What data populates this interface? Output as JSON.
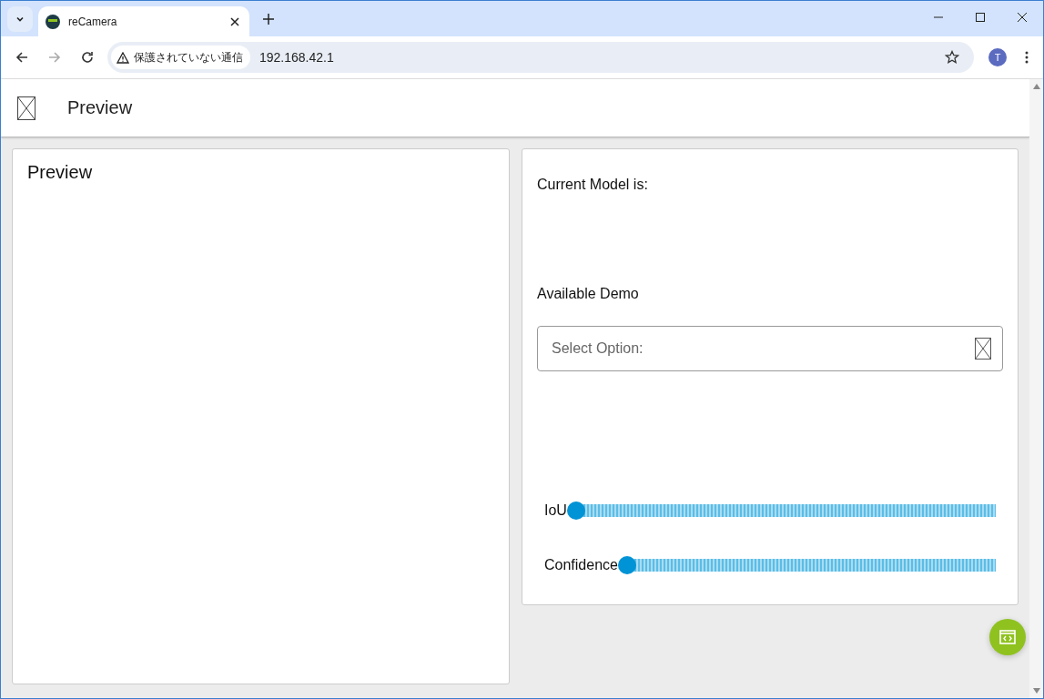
{
  "browser": {
    "tab_title": "reCamera",
    "security_label": "保護されていない通信",
    "url": "192.168.42.1",
    "profile_initial": "T"
  },
  "header": {
    "title": "Preview"
  },
  "preview_card": {
    "title": "Preview"
  },
  "settings_card": {
    "current_model_label": "Current Model is:",
    "available_demo_label": "Available Demo",
    "select": {
      "placeholder": "Select Option:"
    },
    "sliders": [
      {
        "label": "IoU",
        "level": 0
      },
      {
        "label": "Confidence",
        "level": 0
      }
    ]
  }
}
